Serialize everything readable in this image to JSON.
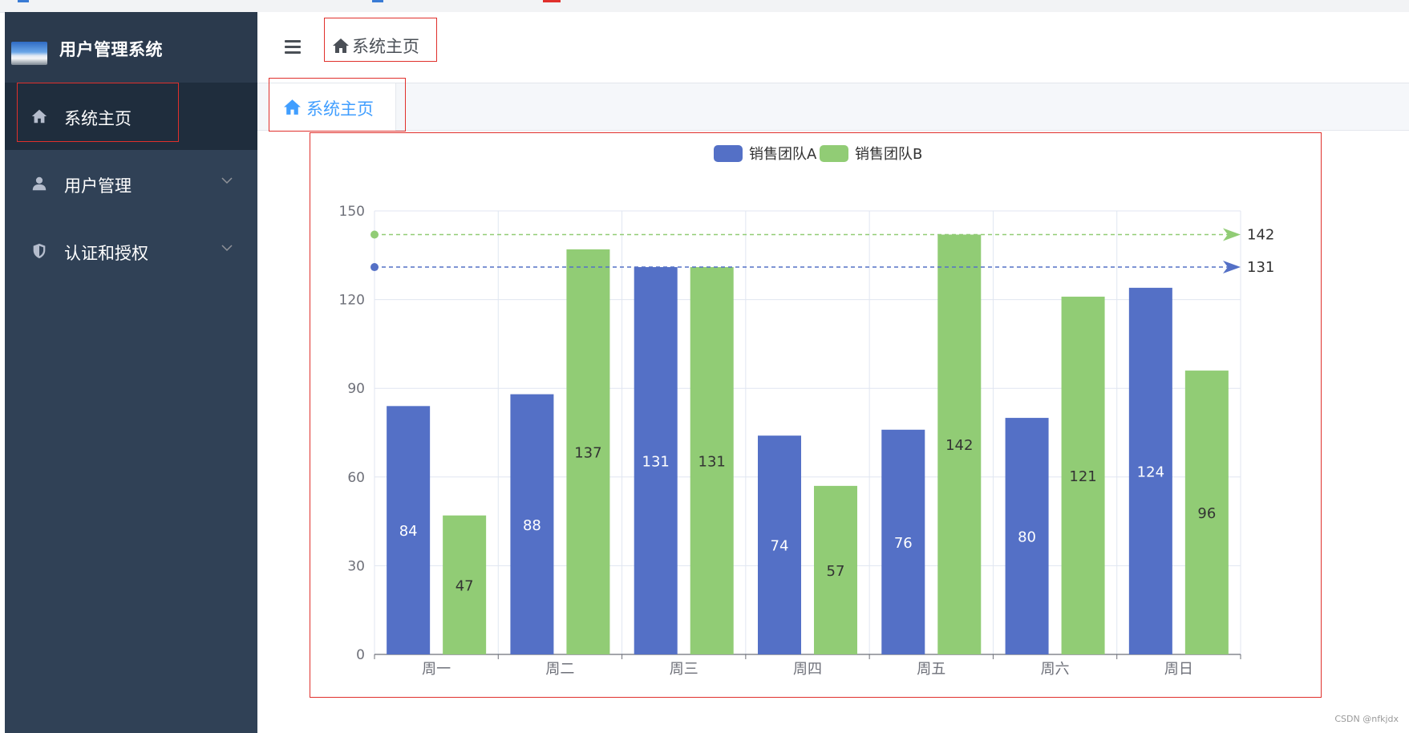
{
  "app": {
    "title": "用户管理系统"
  },
  "sidebar": {
    "items": [
      {
        "label": "系统主页",
        "icon": "home-icon",
        "active": true,
        "has_children": false
      },
      {
        "label": "用户管理",
        "icon": "user-icon",
        "active": false,
        "has_children": true
      },
      {
        "label": "认证和授权",
        "icon": "shield-icon",
        "active": false,
        "has_children": true
      }
    ]
  },
  "navbar": {
    "breadcrumb": "系统主页"
  },
  "tags": [
    {
      "label": "系统主页",
      "icon": "home-icon",
      "active": true
    }
  ],
  "colors": {
    "sidebar_bg": "#304156",
    "sidebar_active_bg": "#1f2d3d",
    "accent": "#409eff",
    "series_a": "#5470c6",
    "series_b": "#91cc75",
    "highlight_box": "#e0302c"
  },
  "chart_data": {
    "type": "bar",
    "categories": [
      "周一",
      "周二",
      "周三",
      "周四",
      "周五",
      "周六",
      "周日"
    ],
    "series": [
      {
        "name": "销售团队A",
        "values": [
          84,
          88,
          131,
          74,
          76,
          80,
          124
        ],
        "color": "#5470c6",
        "label_color": "#ffffff",
        "max_markline": 131
      },
      {
        "name": "销售团队B",
        "values": [
          47,
          137,
          131,
          57,
          142,
          121,
          96
        ],
        "color": "#91cc75",
        "label_color": "#333333",
        "max_markline": 142
      }
    ],
    "ylim": [
      0,
      150
    ],
    "yticks": [
      0,
      30,
      60,
      90,
      120,
      150
    ],
    "grid": true,
    "legend": "top-center",
    "data_labels": "inside-middle",
    "title": "",
    "xlabel": "",
    "ylabel": ""
  },
  "footer": {
    "watermark": "CSDN @nfkjdx"
  }
}
